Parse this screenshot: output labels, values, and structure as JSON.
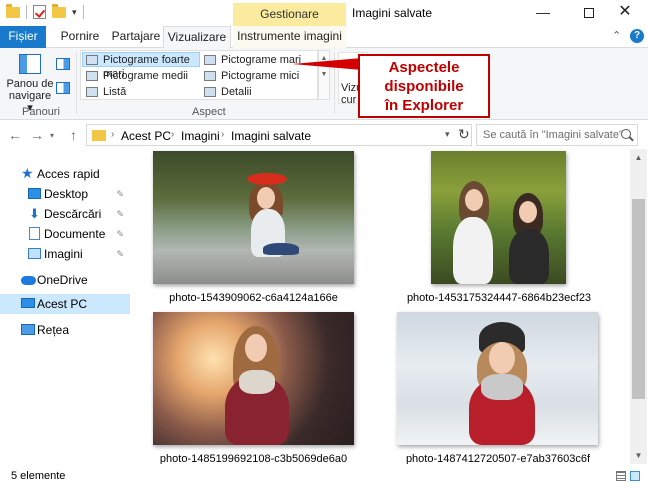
{
  "window": {
    "title": "Imagini salvate",
    "context_tab_group": "Gestionare",
    "qat_dropdown": "▾",
    "minimize": "—",
    "close": "✕"
  },
  "ribbon_tabs": {
    "file": "Fișier",
    "home": "Pornire",
    "share": "Partajare",
    "view": "Vizualizare",
    "picture_tools": "Instrumente imagini",
    "collapse": "⌃"
  },
  "ribbon": {
    "nav_pane_label_line1": "Panou de",
    "nav_pane_label_line2": "navigare ▾",
    "panes_group": "Panouri",
    "layout_group": "Aspect",
    "layouts": [
      "Pictograme foarte mari",
      "Pictograme mari",
      "Pictograme medii",
      "Pictograme mici",
      "Listă",
      "Detalii"
    ],
    "sort_label_line1": "Vizu",
    "sort_label_line2": "cur"
  },
  "callout": {
    "line1": "Aspectele",
    "line2": "disponibile",
    "line3": "în Explorer"
  },
  "address": {
    "crumbs": [
      "Acest PC",
      "Imagini",
      "Imagini salvate"
    ],
    "sep": "›",
    "dropdown": "▾",
    "refresh": "↻",
    "back": "←",
    "forward": "→",
    "history": "▾",
    "up": "↑"
  },
  "search": {
    "placeholder": "Se caută în \"Imagini salvate\""
  },
  "navpane": {
    "quick_access": "Acces rapid",
    "desktop": "Desktop",
    "downloads": "Descărcări",
    "documents": "Documente",
    "pictures": "Imagini",
    "onedrive": "OneDrive",
    "this_pc": "Acest PC",
    "network": "Rețea",
    "pin": "📌"
  },
  "files": [
    {
      "name": "photo-1543909062-c6a4124a166e"
    },
    {
      "name": "photo-1453175324447-6864b23ecf23"
    },
    {
      "name": "photo-1485199692108-c3b5069de6a0"
    },
    {
      "name": "photo-1487412720507-e7ab37603c6f"
    }
  ],
  "status": {
    "count": "5 elemente"
  },
  "colors": {
    "file_tab": "#1979ca",
    "context_tab": "#fbeb9e",
    "selection": "#cce8ff",
    "callout": "#c00000"
  }
}
